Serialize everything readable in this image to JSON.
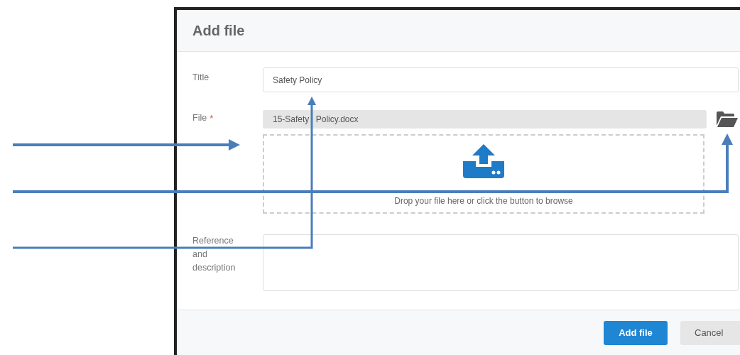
{
  "dialog": {
    "title": "Add file",
    "fields": [
      {
        "kind": "text",
        "label": "Title",
        "value": "Safety Policy"
      },
      {
        "kind": "file",
        "label": "File",
        "required_mark": "*",
        "value": "15-Safety Policy.docx",
        "dropzone_hint": "Drop your file here or click the button to browse"
      },
      {
        "kind": "textarea",
        "label": "Reference and description"
      }
    ],
    "buttons": [
      {
        "kind": "primary",
        "label": "Add file"
      },
      {
        "kind": "secondary",
        "label": "Cancel"
      }
    ]
  }
}
